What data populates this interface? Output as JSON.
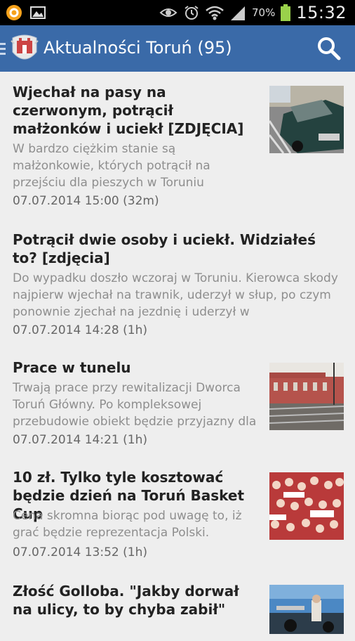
{
  "status_bar": {
    "battery": "70%",
    "time": "15:32"
  },
  "app_bar": {
    "title": "Aktualności Toruń (95)"
  },
  "articles": [
    {
      "title": "Wjechał na pasy na czerwonym, potrącił małżonków i uciekł [ZDJĘCIA]",
      "summary": "W bardzo ciężkim stanie są małżonkowie, których potrącił na przejściu dla pieszych w Toruniu",
      "date": "07.07.2014 15:00 (32m)"
    },
    {
      "title": "Potrącił dwie osoby i uciekł. Widziałeś to? [zdjęcia]",
      "summary": "Do wypadku doszło wczoraj w Toruniu. Kierowca skody najpierw wjechał na trawnik, uderzył w słup, po czym ponownie zjechał na jezdnię i uderzył w",
      "date": "07.07.2014 14:28 (1h)"
    },
    {
      "title": "Prace w tunelu",
      "summary": "Trwają prace przy rewitalizacji Dworca Toruń Główny. Po kompleksowej przebudowie obiekt będzie przyjazny dla",
      "date": "07.07.2014 14:21 (1h)"
    },
    {
      "title": "10 zł. Tylko tyle kosztować będzie dzień na Toruń Basket Cup",
      "summary": "Cena skromna biorąc pod uwagę to, iż grać będzie reprezentacja Polski.",
      "date": "07.07.2014 13:52 (1h)"
    },
    {
      "title": "Złość Golloba. \"Jakby dorwał na ulicy, to by chyba zabił\"",
      "summary": "",
      "date": ""
    }
  ]
}
